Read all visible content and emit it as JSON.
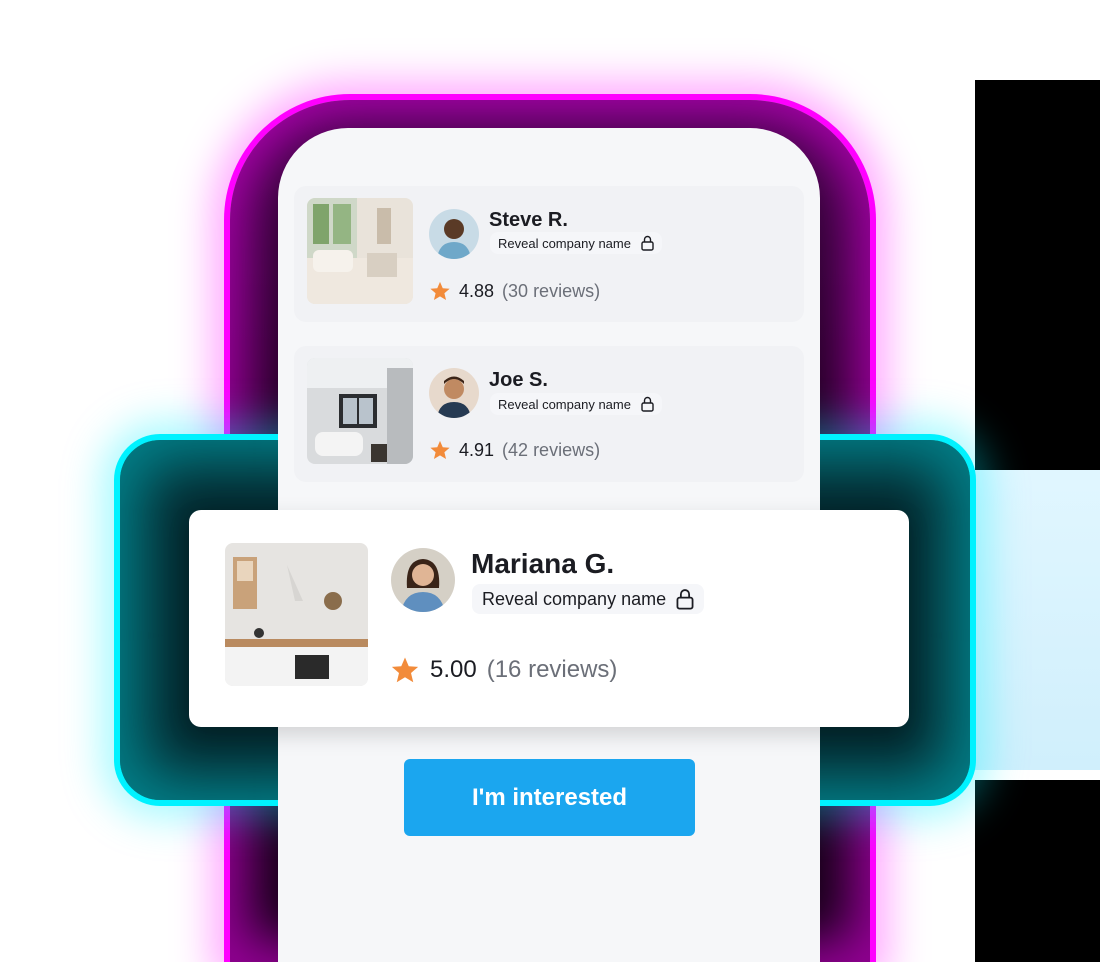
{
  "contractors": [
    {
      "name": "Steve R.",
      "reveal_label": "Reveal company name",
      "rating": "4.88",
      "reviews": "(30 reviews)"
    },
    {
      "name": "Joe S.",
      "reveal_label": "Reveal company name",
      "rating": "4.91",
      "reviews": "(42 reviews)"
    },
    {
      "name": "Mariana G.",
      "reveal_label": "Reveal company name",
      "rating": "5.00",
      "reviews": "(16 reviews)"
    }
  ],
  "cta": {
    "label": "I'm interested"
  },
  "colors": {
    "accent": "#1ba6ef",
    "star": "#f28b3a",
    "glow_magenta": "#ff00ff",
    "glow_cyan": "#00f2ff"
  },
  "icons": {
    "lock": "lock-icon",
    "star": "star-icon"
  }
}
